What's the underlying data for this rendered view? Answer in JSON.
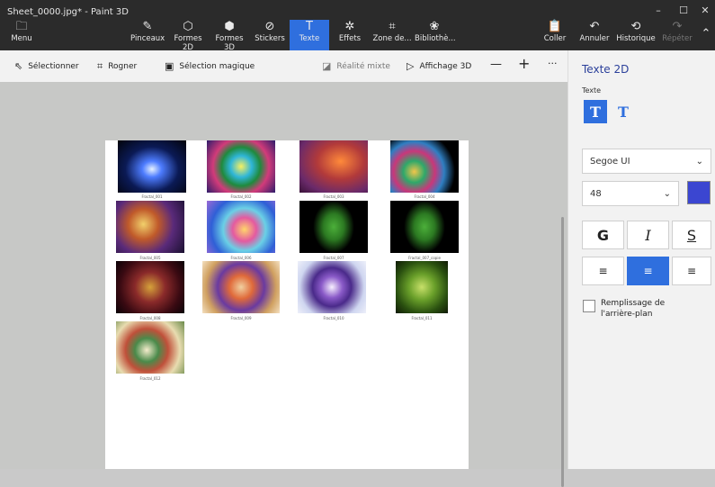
{
  "window": {
    "title": "Sheet_0000.jpg* - Paint 3D",
    "minimize": "–",
    "maximize": "☐",
    "close": "✕"
  },
  "ribbon": {
    "menu": "Menu",
    "tools": [
      {
        "label": "Pinceaux",
        "icon": "brush-icon",
        "glyph": "✎"
      },
      {
        "label": "Formes 2D",
        "icon": "shapes-2d-icon",
        "glyph": "⬡"
      },
      {
        "label": "Formes 3D",
        "icon": "cube-icon",
        "glyph": "⬢"
      },
      {
        "label": "Stickers",
        "icon": "sticker-icon",
        "glyph": "⊘"
      },
      {
        "label": "Texte",
        "icon": "text-icon",
        "glyph": "T"
      },
      {
        "label": "Effets",
        "icon": "effects-icon",
        "glyph": "✲"
      },
      {
        "label": "Zone de...",
        "icon": "canvas-crop-icon",
        "glyph": "⌗"
      },
      {
        "label": "Bibliothè...",
        "icon": "library-icon",
        "glyph": "❀"
      }
    ],
    "paste": "Coller",
    "undo": "Annuler",
    "history": "Historique",
    "redo": "Répéter"
  },
  "toolbar": {
    "select": "Sélectionner",
    "crop": "Rogner",
    "magic_select": "Sélection magique",
    "mixed_reality": "Réalité mixte",
    "view_3d": "Affichage 3D",
    "zoom_out": "—",
    "zoom_in": "+",
    "more": "···"
  },
  "captions": [
    "Fractal_001",
    "Fractal_002",
    "Fractal_003",
    "Fractal_004",
    "Fractal_005",
    "Fractal_006",
    "Fractal_007",
    "Fractal_007_copie",
    "Fractal_008",
    "Fractal_009",
    "Fractal_010",
    "Fractal_011",
    "Fractal_012"
  ],
  "panel": {
    "title": "Texte 2D",
    "text_label": "Texte",
    "font": "Segoe UI",
    "size": "48",
    "color": "#3b46d1",
    "bold": "G",
    "italic": "I",
    "underline": "S",
    "fill_label_1": "Remplissage de",
    "fill_label_2": "l'arrière-plan"
  }
}
